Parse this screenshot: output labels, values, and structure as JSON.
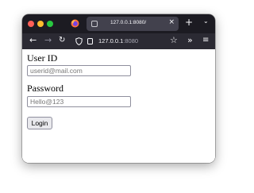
{
  "browser": {
    "tab": {
      "title": "127.0.0.1:8080/",
      "close_glyph": "×"
    },
    "new_tab_glyph": "+",
    "tab_list_glyph": "⌄",
    "nav": {
      "back_glyph": "←",
      "forward_glyph": "→",
      "reload_glyph": "↻",
      "url_host": "127.0.0.1",
      "url_port": ":8080",
      "bookmark_glyph": "☆",
      "overflow_glyph": "»",
      "menu_glyph": "≡"
    },
    "colors": {
      "titlebar": "#1c1b22",
      "active_tab": "#42414d",
      "toolbar": "#2b2a33",
      "close": "#ff5f57",
      "minimize": "#febc2e",
      "maximize": "#28c840"
    }
  },
  "form": {
    "user_label": "User ID",
    "user_placeholder": "userid@mail.com",
    "password_label": "Password",
    "password_placeholder": "Hello@123",
    "login_label": "Login"
  },
  "icons": {
    "traffic_lights": [
      "close-traffic-light",
      "minimize-traffic-light",
      "maximize-traffic-light"
    ],
    "firefox_logo": "firefox-logo-icon",
    "tracking_protection": "shield-icon",
    "connection": "page-icon"
  }
}
